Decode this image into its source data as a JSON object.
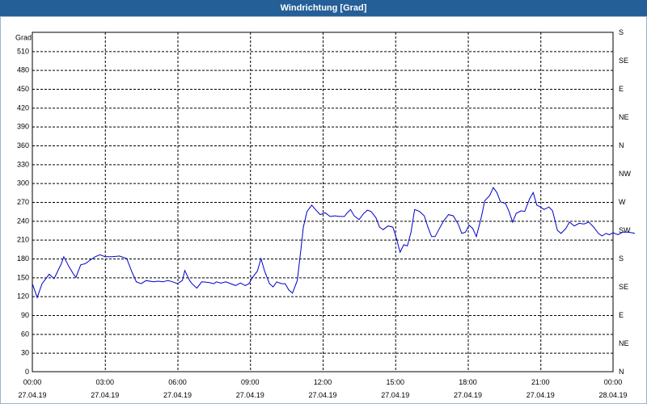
{
  "window": {
    "title": "Windrichtung [Grad]"
  },
  "chart_data": {
    "type": "line",
    "title": "Windrichtung [Grad]",
    "ylabel": "Grad",
    "xlabel": "",
    "ylim": [
      0,
      540
    ],
    "yticks": [
      0,
      30,
      60,
      90,
      120,
      150,
      180,
      210,
      240,
      270,
      300,
      330,
      360,
      390,
      420,
      450,
      480,
      510
    ],
    "compass_ticks": [
      {
        "value": 0,
        "label": "N"
      },
      {
        "value": 45,
        "label": "NE"
      },
      {
        "value": 90,
        "label": "E"
      },
      {
        "value": 135,
        "label": "SE"
      },
      {
        "value": 180,
        "label": "S"
      },
      {
        "value": 225,
        "label": "SW"
      },
      {
        "value": 270,
        "label": "W"
      },
      {
        "value": 315,
        "label": "NW"
      },
      {
        "value": 360,
        "label": "N"
      },
      {
        "value": 405,
        "label": "NE"
      },
      {
        "value": 450,
        "label": "E"
      },
      {
        "value": 495,
        "label": "SE"
      },
      {
        "value": 540,
        "label": "S"
      }
    ],
    "xlim_hours": [
      0,
      24
    ],
    "xticks": [
      {
        "hour": 0,
        "time": "00:00",
        "date": "27.04.19"
      },
      {
        "hour": 3,
        "time": "03:00",
        "date": "27.04.19"
      },
      {
        "hour": 6,
        "time": "06:00",
        "date": "27.04.19"
      },
      {
        "hour": 9,
        "time": "09:00",
        "date": "27.04.19"
      },
      {
        "hour": 12,
        "time": "12:00",
        "date": "27.04.19"
      },
      {
        "hour": 15,
        "time": "15:00",
        "date": "27.04.19"
      },
      {
        "hour": 18,
        "time": "18:00",
        "date": "27.04.19"
      },
      {
        "hour": 21,
        "time": "21:00",
        "date": "27.04.19"
      },
      {
        "hour": 24,
        "time": "00:00",
        "date": "28.04.19"
      }
    ],
    "grid": true,
    "line_color": "#0000c8",
    "series": [
      {
        "values": [
          [
            0.0,
            140
          ],
          [
            0.2,
            118
          ],
          [
            0.4,
            140
          ],
          [
            0.7,
            155
          ],
          [
            0.9,
            148
          ],
          [
            1.2,
            172
          ],
          [
            1.3,
            183
          ],
          [
            1.5,
            168
          ],
          [
            1.7,
            155
          ],
          [
            1.8,
            150
          ],
          [
            2.0,
            170
          ],
          [
            2.2,
            172
          ],
          [
            2.4,
            178
          ],
          [
            2.6,
            183
          ],
          [
            2.8,
            186
          ],
          [
            3.0,
            183
          ],
          [
            3.3,
            183
          ],
          [
            3.6,
            184
          ],
          [
            3.9,
            180
          ],
          [
            4.1,
            160
          ],
          [
            4.3,
            143
          ],
          [
            4.5,
            140
          ],
          [
            4.7,
            145
          ],
          [
            5.0,
            143
          ],
          [
            5.2,
            144
          ],
          [
            5.4,
            143
          ],
          [
            5.6,
            145
          ],
          [
            5.8,
            143
          ],
          [
            6.0,
            140
          ],
          [
            6.2,
            145
          ],
          [
            6.3,
            161
          ],
          [
            6.5,
            145
          ],
          [
            6.6,
            140
          ],
          [
            6.8,
            133
          ],
          [
            7.0,
            143
          ],
          [
            7.3,
            142
          ],
          [
            7.5,
            140
          ],
          [
            7.6,
            143
          ],
          [
            7.8,
            141
          ],
          [
            8.0,
            143
          ],
          [
            8.2,
            140
          ],
          [
            8.4,
            137
          ],
          [
            8.6,
            141
          ],
          [
            8.8,
            137
          ],
          [
            8.95,
            140
          ],
          [
            9.1,
            150
          ],
          [
            9.3,
            160
          ],
          [
            9.45,
            180
          ],
          [
            9.6,
            160
          ],
          [
            9.8,
            140
          ],
          [
            9.95,
            135
          ],
          [
            10.1,
            143
          ],
          [
            10.3,
            140
          ],
          [
            10.45,
            140
          ],
          [
            10.6,
            130
          ],
          [
            10.75,
            125
          ],
          [
            10.95,
            145
          ],
          [
            11.1,
            195
          ],
          [
            11.2,
            230
          ],
          [
            11.35,
            255
          ],
          [
            11.55,
            265
          ],
          [
            11.7,
            258
          ],
          [
            11.9,
            250
          ],
          [
            12.1,
            253
          ],
          [
            12.3,
            247
          ],
          [
            12.5,
            248
          ],
          [
            12.7,
            247
          ],
          [
            12.9,
            247
          ],
          [
            13.0,
            252
          ],
          [
            13.15,
            258
          ],
          [
            13.3,
            248
          ],
          [
            13.5,
            242
          ],
          [
            13.7,
            252
          ],
          [
            13.85,
            257
          ],
          [
            14.0,
            255
          ],
          [
            14.2,
            245
          ],
          [
            14.35,
            230
          ],
          [
            14.5,
            226
          ],
          [
            14.7,
            232
          ],
          [
            14.9,
            230
          ],
          [
            15.05,
            212
          ],
          [
            15.2,
            190
          ],
          [
            15.35,
            202
          ],
          [
            15.5,
            200
          ],
          [
            15.65,
            222
          ],
          [
            15.8,
            258
          ],
          [
            16.0,
            255
          ],
          [
            16.2,
            248
          ],
          [
            16.35,
            230
          ],
          [
            16.5,
            215
          ],
          [
            16.65,
            215
          ],
          [
            16.8,
            226
          ],
          [
            17.0,
            240
          ],
          [
            17.2,
            250
          ],
          [
            17.4,
            248
          ],
          [
            17.6,
            235
          ],
          [
            17.75,
            220
          ],
          [
            17.9,
            222
          ],
          [
            18.05,
            233
          ],
          [
            18.2,
            228
          ],
          [
            18.35,
            215
          ],
          [
            18.55,
            245
          ],
          [
            18.7,
            272
          ],
          [
            18.9,
            280
          ],
          [
            19.05,
            293
          ],
          [
            19.2,
            285
          ],
          [
            19.35,
            270
          ],
          [
            19.55,
            268
          ],
          [
            19.7,
            255
          ],
          [
            19.85,
            238
          ],
          [
            20.0,
            252
          ],
          [
            20.2,
            256
          ],
          [
            20.35,
            255
          ],
          [
            20.55,
            275
          ],
          [
            20.7,
            285
          ],
          [
            20.85,
            265
          ],
          [
            21.0,
            262
          ],
          [
            21.15,
            258
          ],
          [
            21.35,
            262
          ],
          [
            21.5,
            256
          ],
          [
            21.7,
            225
          ],
          [
            21.85,
            220
          ],
          [
            22.05,
            228
          ],
          [
            22.2,
            238
          ],
          [
            22.4,
            232
          ],
          [
            22.6,
            236
          ],
          [
            22.8,
            235
          ],
          [
            23.0,
            238
          ],
          [
            23.2,
            230
          ],
          [
            23.4,
            220
          ],
          [
            23.55,
            216
          ],
          [
            23.7,
            220
          ],
          [
            23.85,
            218
          ],
          [
            24.0,
            221
          ],
          [
            24.2,
            218
          ],
          [
            24.4,
            222
          ],
          [
            24.6,
            222
          ],
          [
            24.8,
            221
          ],
          [
            24.9,
            220
          ]
        ]
      }
    ]
  }
}
